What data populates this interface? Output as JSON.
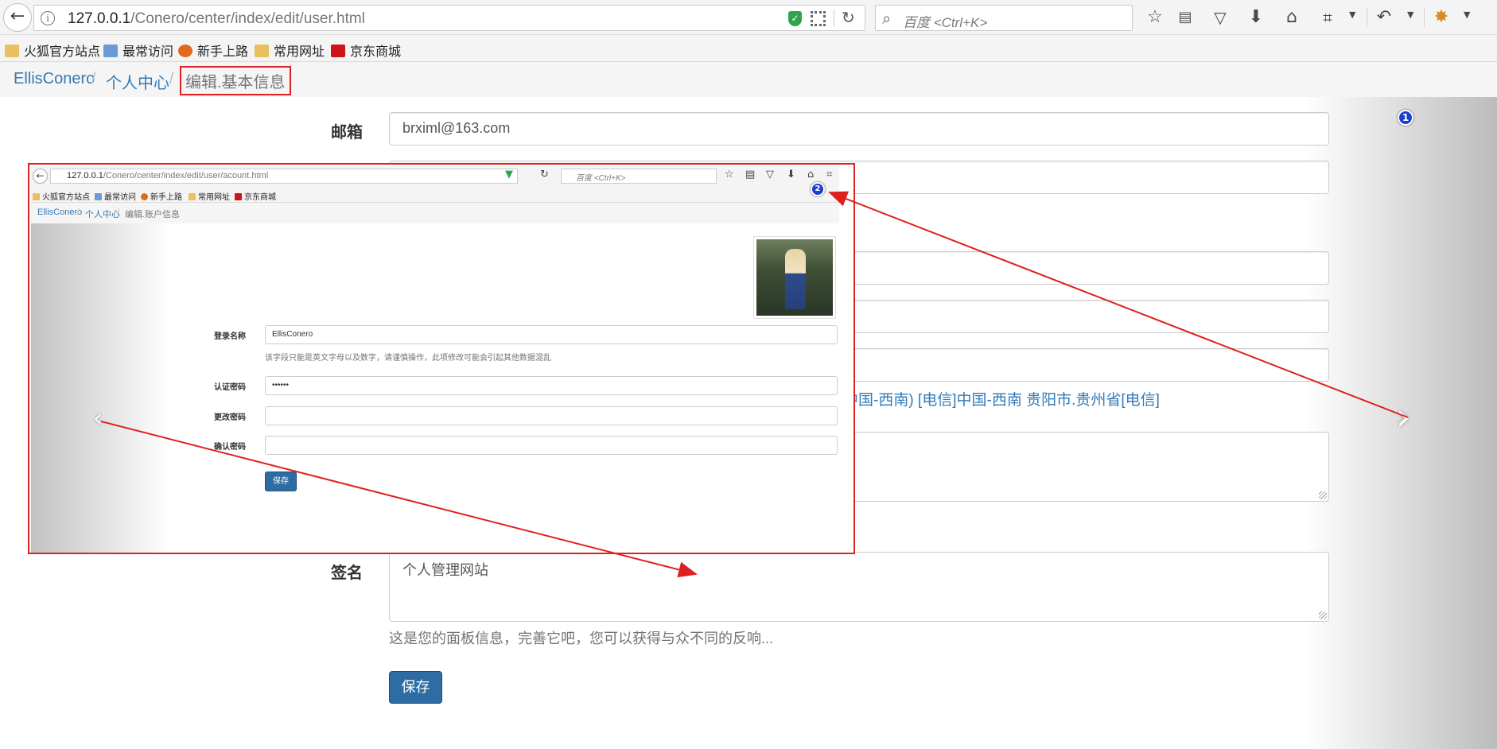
{
  "browser": {
    "url_host": "127.0.0.1",
    "url_path": "/Conero/center/index/edit/user.html",
    "search_placeholder": "百度 <Ctrl+K>"
  },
  "bookmarks": [
    {
      "label": "火狐官方站点",
      "icon": "folder-icon"
    },
    {
      "label": "最常访问",
      "icon": "frequent-icon"
    },
    {
      "label": "新手上路",
      "icon": "firefox-icon"
    },
    {
      "label": "常用网址",
      "icon": "folder-icon"
    },
    {
      "label": "京东商城",
      "icon": "jd-icon"
    }
  ],
  "breadcrumb": {
    "home": "EllisConero",
    "center": "个人中心",
    "current": "编辑.基本信息"
  },
  "form": {
    "email_label": "邮箱",
    "email_value": "brximl@163.com",
    "ip_text": "中国-西南) [电信]中国-西南 贵阳市.贵州省[电信]",
    "signature_label": "签名",
    "signature_value": "个人管理网站",
    "signature_help": "这是您的面板信息，完善它吧，您可以获得与众不同的反响...",
    "save_label": "保存"
  },
  "badges": {
    "first": "1",
    "second": "2"
  },
  "inset": {
    "url_host": "127.0.0.1",
    "url_path": "/Conero/center/index/edit/user/acount.html",
    "search_placeholder": "百度 <Ctrl+K>",
    "bookmarks": [
      "火狐官方站点",
      "最常访问",
      "新手上路",
      "常用网址",
      "京东商城"
    ],
    "crumb_home": "EllisConero",
    "crumb_center": "个人中心",
    "crumb_current": "编辑.账户信息",
    "login_label": "登录名称",
    "login_value": "EllisConero",
    "login_help": "该字段只能是英文字母以及数字，请谨慎操作，此项修改可能会引起其他数据混乱",
    "auth_label": "认证密码",
    "auth_value": "••••••",
    "change_label": "更改密码",
    "confirm_label": "确认密码",
    "save_label": "保存"
  },
  "colors": {
    "link": "#337ab7",
    "primary_button": "#2e6da4",
    "annotation_red": "#e02020",
    "badge_blue": "#1a3fcc"
  }
}
